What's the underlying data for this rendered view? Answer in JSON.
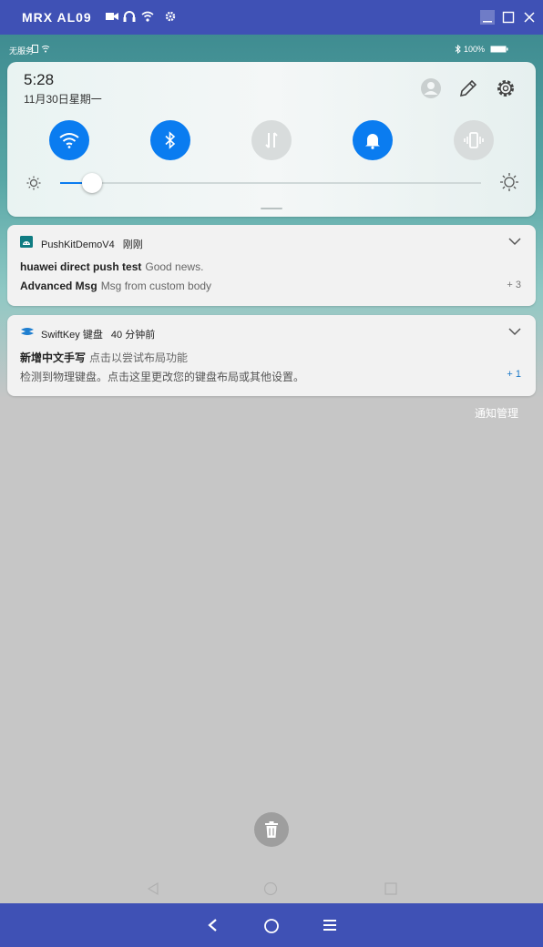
{
  "window": {
    "title": "MRX AL09",
    "icons": [
      "video-camera-icon",
      "headset-icon",
      "wifi-icon",
      "gear-icon"
    ],
    "controls": [
      "minimize-icon",
      "maximize-icon",
      "close-icon"
    ]
  },
  "statusbar": {
    "left": "无服务",
    "battery": "100%"
  },
  "quick_settings": {
    "time": "5:28",
    "date": "11月30日星期一",
    "toggles": [
      {
        "name": "wifi",
        "state": "on"
      },
      {
        "name": "bluetooth",
        "state": "on"
      },
      {
        "name": "mobile-data",
        "state": "off"
      },
      {
        "name": "sound",
        "state": "on"
      },
      {
        "name": "vibrate",
        "state": "off"
      }
    ],
    "brightness_level": 0.07,
    "accent": "#0a7cf0"
  },
  "notifications": [
    {
      "app": "PushKitDemoV4",
      "time": "刚刚",
      "lines": [
        {
          "title": "huawei direct push test",
          "body": "Good news."
        },
        {
          "title": "Advanced Msg",
          "body": "Msg from custom body"
        }
      ],
      "count": "+ 3"
    },
    {
      "app": "SwiftKey 键盘",
      "time": "40 分钟前",
      "lines": [
        {
          "title": "新增中文手写",
          "body": "点击以尝试布局功能"
        },
        {
          "title": "",
          "body": "检测到物理键盘。点击这里更改您的键盘布局或其他设置。"
        }
      ],
      "count": "+ 1"
    }
  ],
  "manage_label": "通知管理",
  "colors": {
    "titlebar": "#3f51b5",
    "count_blue": "#1a78c8",
    "background": "#c6c6c6"
  }
}
